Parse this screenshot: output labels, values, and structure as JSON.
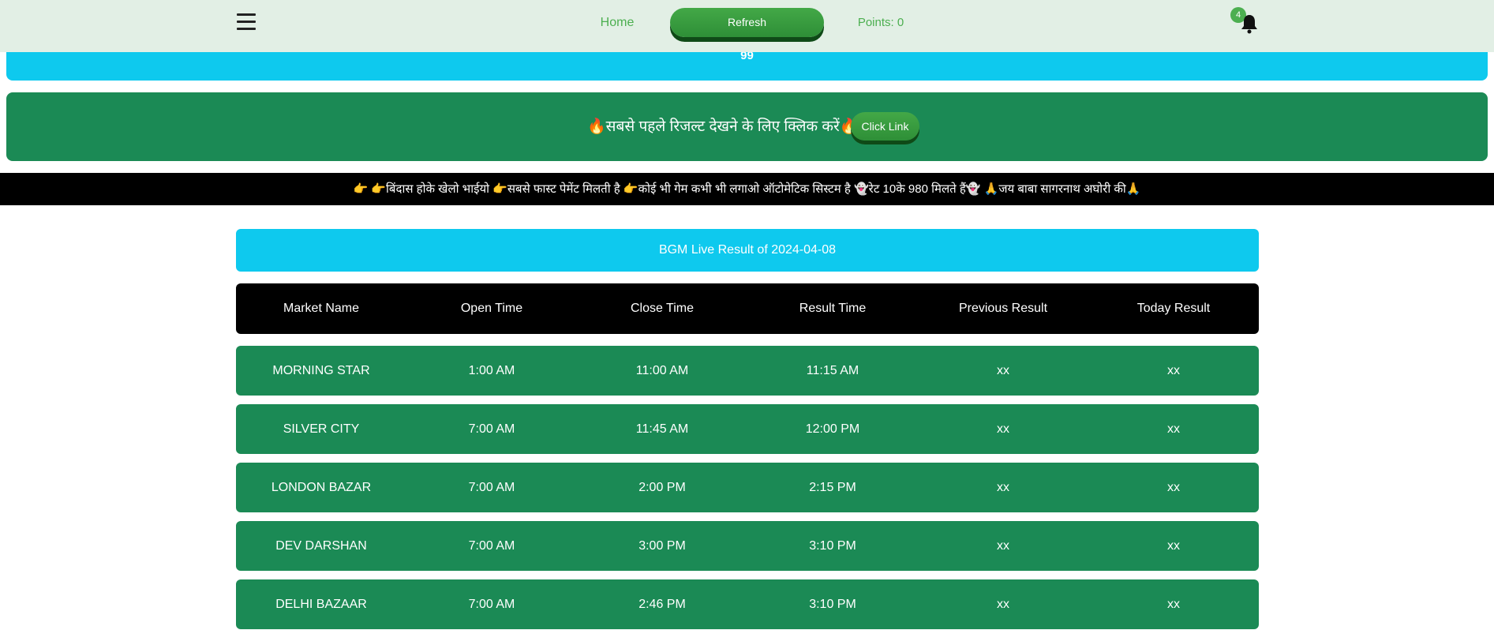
{
  "header": {
    "home_label": "Home",
    "refresh_label": "Refresh",
    "points_label": "Points: 0",
    "notification_count": "4"
  },
  "banner": {
    "number": "99"
  },
  "promo": {
    "text": "🔥सबसे पहले रिजल्ट देखने के लिए क्लिक करें🔥",
    "button_label": "Click Link"
  },
  "ticker": {
    "text": "👉 👉बिंदास होके खेलो भाईयो 👉सबसे फास्ट पेमेंट मिलती है 👉कोई भी गेम कभी भी लगाओ ऑटोमेटिक सिस्टम है 👻रेट 10के 980 मिलते हैं👻 🙏जय बाबा सागरनाथ अघोरी की🙏"
  },
  "results": {
    "title": "BGM Live Result of 2024-04-08",
    "columns": [
      "Market Name",
      "Open Time",
      "Close Time",
      "Result Time",
      "Previous Result",
      "Today Result"
    ],
    "rows": [
      [
        "MORNING STAR",
        "1:00 AM",
        "11:00 AM",
        "11:15 AM",
        "xx",
        "xx"
      ],
      [
        "SILVER CITY",
        "7:00 AM",
        "11:45 AM",
        "12:00 PM",
        "xx",
        "xx"
      ],
      [
        "LONDON BAZAR",
        "7:00 AM",
        "2:00 PM",
        "2:15 PM",
        "xx",
        "xx"
      ],
      [
        "DEV DARSHAN",
        "7:00 AM",
        "3:00 PM",
        "3:10 PM",
        "xx",
        "xx"
      ],
      [
        "DELHI BAZAAR",
        "7:00 AM",
        "2:46 PM",
        "3:10 PM",
        "xx",
        "xx"
      ]
    ]
  },
  "icons": {
    "menu": "menu-icon",
    "notifications": "bell-icon"
  },
  "colors": {
    "topbar": "#e2efe5",
    "accent_green": "#4caf50",
    "cyan": "#0ec9ee",
    "row_green": "#1b8a55",
    "header_black": "#000000"
  }
}
